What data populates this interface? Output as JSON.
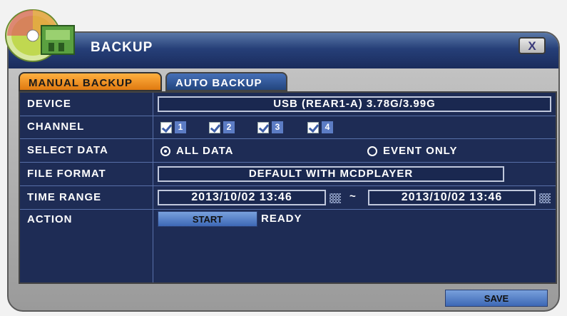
{
  "window": {
    "title": "BACKUP",
    "close_label": "X"
  },
  "tabs": [
    {
      "label": "MANUAL BACKUP",
      "active": true
    },
    {
      "label": "AUTO BACKUP",
      "active": false
    }
  ],
  "device": {
    "label": "DEVICE",
    "value": "USB (REAR1-A) 3.78G/3.99G"
  },
  "channel": {
    "label": "CHANNEL",
    "items": [
      {
        "number": "1",
        "checked": true
      },
      {
        "number": "2",
        "checked": true
      },
      {
        "number": "3",
        "checked": true
      },
      {
        "number": "4",
        "checked": true
      }
    ]
  },
  "select_data": {
    "label": "SELECT DATA",
    "options": [
      {
        "label": "ALL DATA",
        "selected": true
      },
      {
        "label": "EVENT ONLY",
        "selected": false
      }
    ]
  },
  "file_format": {
    "label": "FILE FORMAT",
    "value": "DEFAULT WITH MCDPLAYER"
  },
  "time_range": {
    "label": "TIME RANGE",
    "start": "2013/10/02  13:46",
    "separator": "~",
    "end": "2013/10/02  13:46"
  },
  "action": {
    "label": "ACTION",
    "start_label": "START",
    "status": "READY"
  },
  "footer": {
    "save_label": "SAVE"
  },
  "colors": {
    "accent": "#e07a10",
    "panel": "#1e2c55",
    "button": "#3d68b5"
  }
}
